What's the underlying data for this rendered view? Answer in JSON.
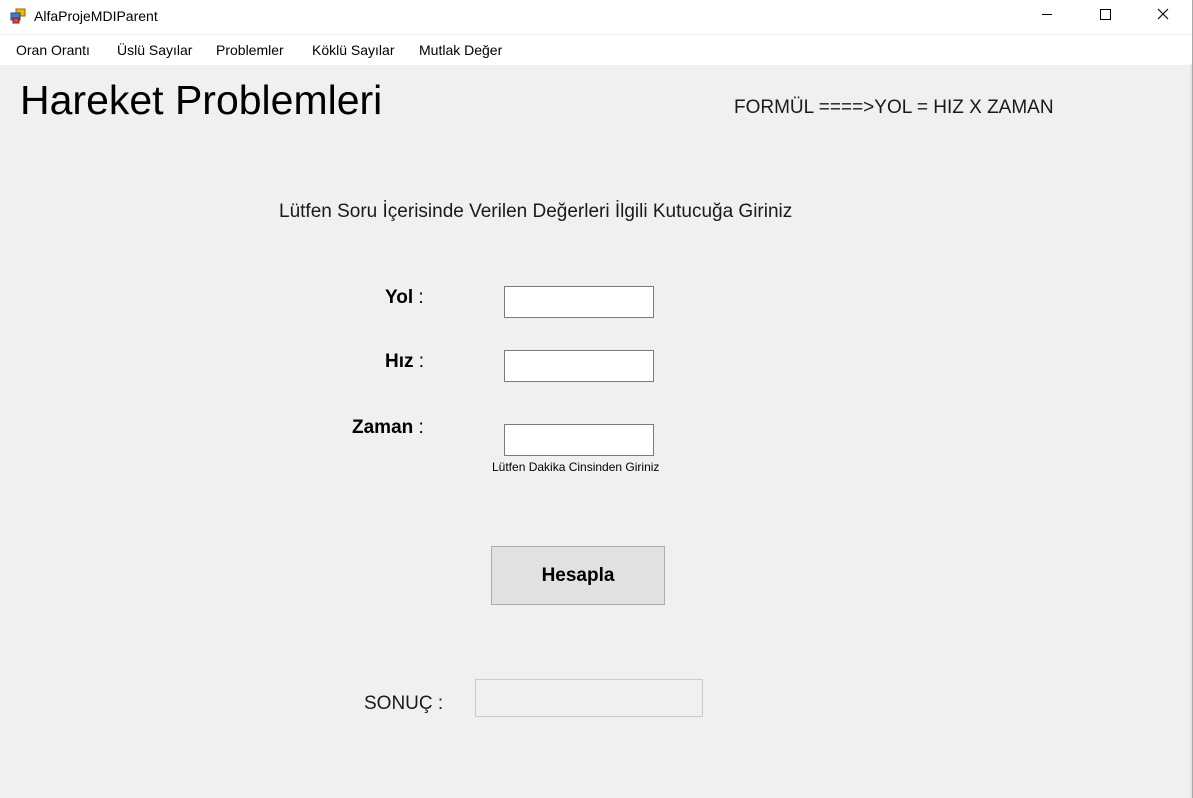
{
  "window": {
    "title": "AlfaProjeMDIParent",
    "icon": "app-window-icon",
    "controls": [
      "minimize-icon",
      "maximize-icon",
      "close-icon"
    ]
  },
  "menu": {
    "items": [
      {
        "label": "Oran Orantı"
      },
      {
        "label": "Üslü Sayılar"
      },
      {
        "label": "Problemler"
      },
      {
        "label": "Köklü Sayılar"
      },
      {
        "label": "Mutlak Değer"
      }
    ]
  },
  "main": {
    "title": "Hareket Problemleri",
    "formula": "FORMÜL ====>YOL = HIZ X ZAMAN",
    "instruction": "Lütfen Soru İçerisinde Verilen Değerleri İlgili Kutucuğa Giriniz",
    "fields": {
      "yol": {
        "label": "Yol",
        "colon": " :",
        "value": ""
      },
      "hiz": {
        "label": "Hız",
        "colon": " :",
        "value": ""
      },
      "zaman": {
        "label": "Zaman",
        "colon": " :",
        "value": "",
        "hint": "Lütfen Dakika Cinsinden Giriniz"
      }
    },
    "button_label": "Hesapla",
    "result": {
      "label": "SONUÇ :",
      "value": ""
    }
  },
  "colors": {
    "background": "#f0f0f0",
    "titlebar": "#ffffff",
    "button": "#e1e1e1"
  }
}
